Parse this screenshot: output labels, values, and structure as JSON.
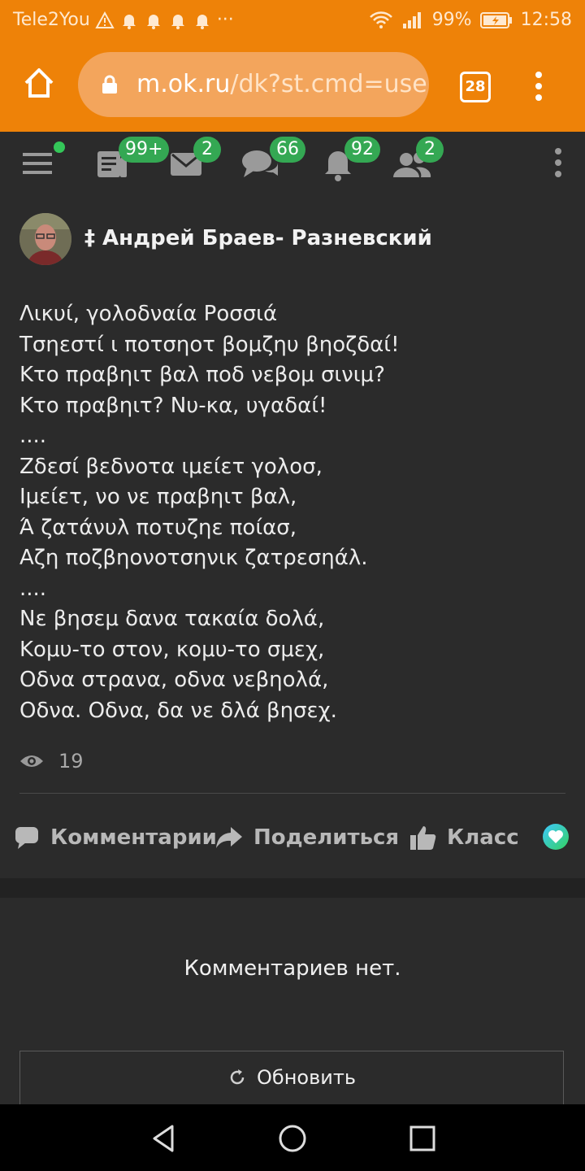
{
  "status_bar": {
    "carrier": "Tele2You",
    "extra_indicator": "···",
    "battery": "99%",
    "time": "12:58",
    "icons": [
      "warning-icon",
      "bell-icon",
      "bell-icon",
      "bell-icon",
      "bell-icon",
      "wifi-icon",
      "signal-icon",
      "battery-icon"
    ]
  },
  "browser": {
    "url_host": "m.ok.ru",
    "url_path": "/dk?st.cmd=user",
    "tab_count": "28"
  },
  "nav": {
    "badges": {
      "feed": "99+",
      "messages": "2",
      "discussions": "66",
      "notifications": "92",
      "friends": "2"
    }
  },
  "post": {
    "author": "‡ Андрей Браев- Разневский",
    "lines": [
      "Λικυί, γολοδναία Ροσσιά",
      "Τσηεστί ι ποτσηοτ βομζηυ βηοζδαί!",
      "Κτο πραβηιτ βαλ ποδ νεβομ σινιμ?",
      "Κτο πραβηιτ? Νυ-κα, υγαδαί!",
      "....",
      "Ζδεσί βεδνοτα ιμείετ γολοσ,",
      "Ιμείετ, νο νε πραβηιτ βαλ,",
      "Ά ζατάνυλ ποτυζηε ποίασ,",
      "Αζη ποζβηονοτσηνικ ζατρεσηάλ.",
      "....",
      "Νε βησεμ δανα τακαία δολά,",
      "Κομυ-το στον, κομυ-το σμεχ,",
      "Οδνα στρανα, οδνα νεβηολά,",
      "Οδνα. Οδνα, δα νε δλά βησεχ."
    ],
    "views": "19"
  },
  "actions": {
    "comment": "Комментарии",
    "share": "Поделиться",
    "like": "Класс"
  },
  "comments": {
    "empty_text": "Комментариев нет.",
    "refresh": "Обновить"
  },
  "colors": {
    "accent": "#ee8208",
    "badge": "#34a853",
    "background": "#2b2b2b"
  }
}
